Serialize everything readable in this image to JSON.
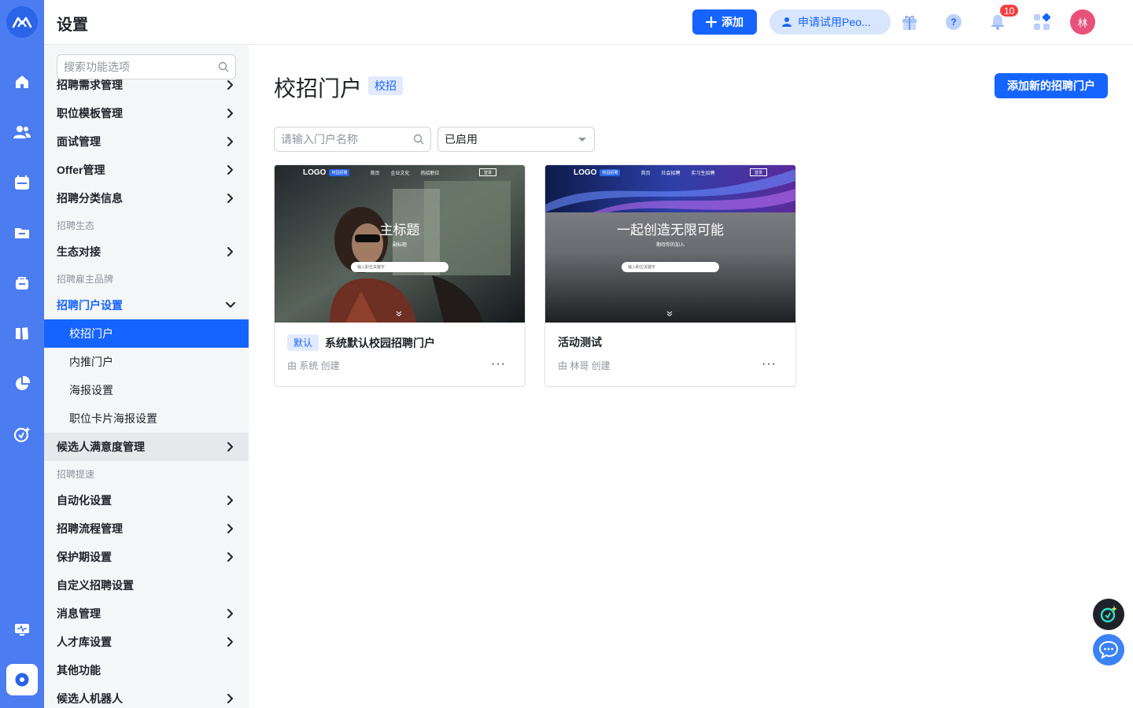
{
  "header": {
    "title": "设置",
    "add_label": "添加",
    "trial_label": "申请试用Peo...",
    "notification_count": "10",
    "avatar_text": "林"
  },
  "sidebar": {
    "search_placeholder": "搜索功能选项",
    "items": [
      {
        "type": "item",
        "label": "招聘需求管理",
        "chevron": "right"
      },
      {
        "type": "item",
        "label": "职位模板管理",
        "chevron": "right"
      },
      {
        "type": "item",
        "label": "面试管理",
        "chevron": "right"
      },
      {
        "type": "item",
        "label": "Offer管理",
        "chevron": "right"
      },
      {
        "type": "item",
        "label": "招聘分类信息",
        "chevron": "right"
      },
      {
        "type": "group",
        "label": "招聘生态"
      },
      {
        "type": "item",
        "label": "生态对接",
        "chevron": "right"
      },
      {
        "type": "group",
        "label": "招聘雇主品牌"
      },
      {
        "type": "item",
        "label": "招聘门户设置",
        "chevron": "down",
        "state": "open"
      },
      {
        "type": "sub",
        "label": "校招门户",
        "state": "selected"
      },
      {
        "type": "sub",
        "label": "内推门户"
      },
      {
        "type": "sub",
        "label": "海报设置"
      },
      {
        "type": "sub",
        "label": "职位卡片海报设置"
      },
      {
        "type": "item",
        "label": "候选人满意度管理",
        "chevron": "right",
        "state": "hover"
      },
      {
        "type": "group",
        "label": "招聘提速"
      },
      {
        "type": "item",
        "label": "自动化设置",
        "chevron": "right"
      },
      {
        "type": "item",
        "label": "招聘流程管理",
        "chevron": "right"
      },
      {
        "type": "item",
        "label": "保护期设置",
        "chevron": "right"
      },
      {
        "type": "item",
        "label": "自定义招聘设置",
        "chevron": "none"
      },
      {
        "type": "item",
        "label": "消息管理",
        "chevron": "right"
      },
      {
        "type": "item",
        "label": "人才库设置",
        "chevron": "right"
      },
      {
        "type": "item",
        "label": "其他功能",
        "chevron": "none"
      },
      {
        "type": "item",
        "label": "候选人机器人",
        "chevron": "right"
      }
    ]
  },
  "main": {
    "title": "校招门户",
    "tag": "校招",
    "add_button": "添加新的招聘门户",
    "search_placeholder": "请输入门户名称",
    "filter_value": "已启用",
    "cards": [
      {
        "tag": "默认",
        "name": "系统默认校园招聘门户",
        "by": "由 系统 创建",
        "more": "···",
        "preview": {
          "logo": "LOGO",
          "pill": "校园招聘",
          "nav": [
            "首页",
            "企业文化",
            "热招职位"
          ],
          "login": "登录",
          "heading": "主标题",
          "sub": "副标题",
          "search": "输入职位关键字"
        }
      },
      {
        "tag": "",
        "name": "活动测试",
        "by": "由 林哥 创建",
        "more": "···",
        "preview": {
          "logo": "LOGO",
          "pill": "校园招聘",
          "nav": [
            "首页",
            "社会招聘",
            "实习生招聘"
          ],
          "login": "登录",
          "heading": "一起创造无限可能",
          "sub": "期待你的加入",
          "search": "输入职位关键字"
        }
      }
    ]
  },
  "colors": {
    "rail": "#4b7cf0",
    "primary": "#1664ff",
    "badge": "#f53f3f",
    "avatar": "#e8527a"
  },
  "icons": {
    "rail": [
      "home-icon",
      "users-icon",
      "calendar-icon",
      "folder-icon",
      "briefcase-icon",
      "book-icon",
      "pie-chart-icon",
      "ai-assistant-icon",
      "monitor-icon",
      "settings-icon"
    ],
    "header": [
      "gift-icon",
      "help-icon",
      "bell-icon",
      "apps-icon"
    ]
  }
}
